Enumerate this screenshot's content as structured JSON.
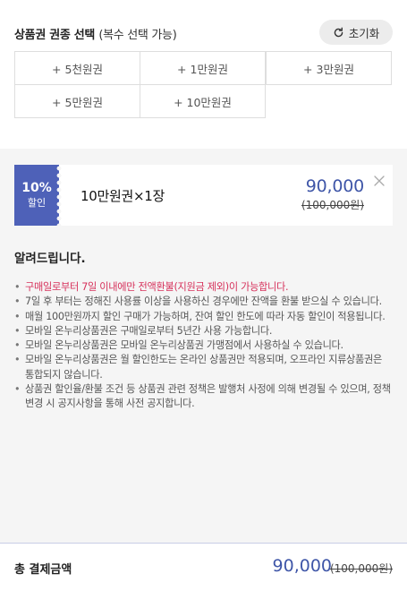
{
  "header": {
    "title": "상품권 권종 선택",
    "title_sub": "(복수 선택 가능)",
    "reset_label": "초기화",
    "reset_icon": "refresh-icon"
  },
  "options": [
    "+ 5천원권",
    "+ 1만원권",
    "+ 3만원권",
    "+ 5만원권",
    "+ 10만원권"
  ],
  "selected_item": {
    "discount_pct": "10%",
    "discount_label": "할인",
    "name": "10만원권",
    "multiplier": "×",
    "quantity": "1장",
    "price": "90,000",
    "original_price": "(100,000원)",
    "remove_icon": "close-icon"
  },
  "notice": {
    "title": "알려드립니다.",
    "items": [
      "구매일로부터 7일 이내에만 전액환불(지원금 제외)이 가능합니다.",
      "7일 후 부터는 정해진 사용률 이상을 사용하신 경우에만 잔액을 환불 받으실 수 있습니다.",
      "매월 100만원까지 할인 구매가 가능하며, 잔여 할인 한도에 따라 자동 할인이 적용됩니다.",
      "모바일 온누리상품권은 구매일로부터 5년간 사용 가능합니다.",
      "모바일 온누리상품권은 모바일 온누리상품권 가맹점에서 사용하실 수 있습니다.",
      "모바일 온누리상품권은 월 할인한도는 온라인 상품권만 적용되며, 오프라인 지류상품권은 통합되지 않습니다.",
      "상품권 할인율/환불 조건 등 상품권 관련 정책은 발행처 사정에 의해 변경될 수 있으며, 정책 변경 시 공지사항을 통해 사전 공지합니다."
    ]
  },
  "footer": {
    "label": "총 결제금액",
    "total": "90,000",
    "original_total": "(100,000원)"
  },
  "colors": {
    "accent": "#4e61b8",
    "price": "#3f56a8",
    "warning": "#d6305a"
  }
}
